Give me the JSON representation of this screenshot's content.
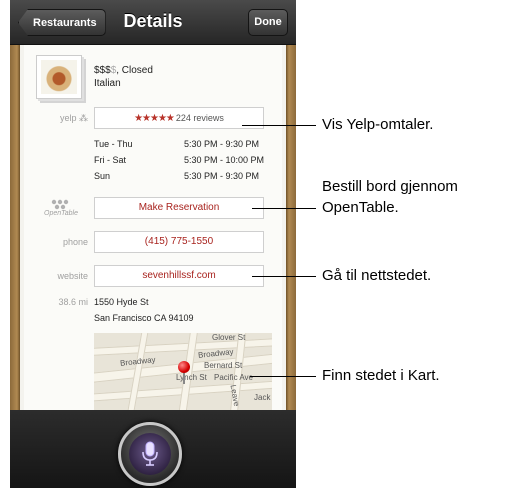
{
  "navbar": {
    "back_label": "Restaurants",
    "title": "Details",
    "done_label": "Done"
  },
  "restaurant": {
    "price_active": "$$$",
    "price_inactive": "$",
    "status": ", Closed",
    "cuisine": "Italian"
  },
  "yelp": {
    "label": "yelp",
    "stars": "★★★★★",
    "reviews": "224 reviews"
  },
  "hours": [
    {
      "days": "Tue - Thu",
      "time": "5:30 PM -  9:30 PM"
    },
    {
      "days": "Fri - Sat",
      "time": "5:30 PM - 10:00 PM"
    },
    {
      "days": "Sun",
      "time": "5:30 PM -  9:30 PM"
    }
  ],
  "opentable": {
    "label": "OpenTable",
    "button": "Make Reservation"
  },
  "phone": {
    "label": "phone",
    "value": "(415) 775-1550"
  },
  "website": {
    "label": "website",
    "value": "sevenhillssf.com"
  },
  "address": {
    "distance": "38.6 mi",
    "line1": "1550 Hyde St",
    "line2": "San Francisco CA 94109"
  },
  "map": {
    "streets": [
      "Glover St",
      "Broadway",
      "Broadway",
      "Bernard St",
      "Pacific Ave",
      "Lynch St",
      "Leave",
      "Jack"
    ]
  },
  "callouts": {
    "yelp": "Vis Yelp-omtaler.",
    "opentable_line1": "Bestill bord gjennom",
    "opentable_line2": "OpenTable.",
    "website": "Gå til nettstedet.",
    "map": "Finn stedet i Kart."
  },
  "icons": {
    "mic": "microphone-icon",
    "pin": "map-pin-icon"
  },
  "colors": {
    "accent_red": "#a8231e",
    "siri_purple": "#6b5a8a"
  }
}
